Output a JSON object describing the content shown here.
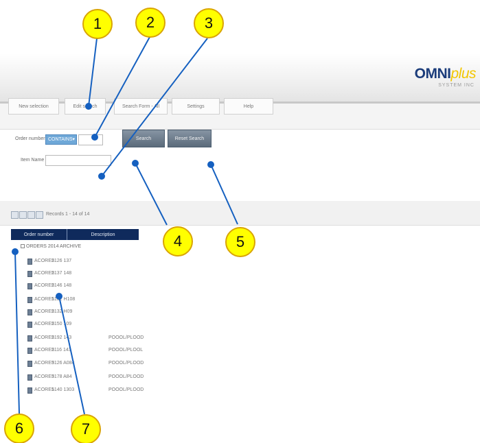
{
  "header": {
    "logo_main": "OMNI",
    "logo_accent": "plus",
    "logo_sub": "SYSTEM INC"
  },
  "tabs": [
    {
      "label": "New selection"
    },
    {
      "label": "Edit search"
    },
    {
      "label": "Search Form - All"
    },
    {
      "label": "Settings"
    },
    {
      "label": "Help"
    }
  ],
  "form": {
    "field1_label": "Order number",
    "field1_select_value": "CONTAINS",
    "field1_value": "",
    "field2_label": "Item Name",
    "field2_value": "",
    "search_button": "Search",
    "reset_button": "Reset Search"
  },
  "results": {
    "pager_text": "Records 1 - 14 of 14",
    "columns": [
      "Order number",
      "Description"
    ],
    "root_label": "ORDERS 2014 ARCHIVE",
    "rows": [
      {
        "id": "ACORE2",
        "code": "5126 137",
        "desc": ""
      },
      {
        "id": "ACORE2",
        "code": "5137 148",
        "desc": ""
      },
      {
        "id": "ACORE2",
        "code": "5146 148",
        "desc": ""
      },
      {
        "id": "ACORE1",
        "code": "5132 H108",
        "desc": ""
      },
      {
        "id": "ACORE2",
        "code": "5132 H09",
        "desc": ""
      },
      {
        "id": "ACORE2",
        "code": "5150 109",
        "desc": ""
      },
      {
        "id": "ACORE2",
        "code": "5192 143",
        "desc": "POOOL/PLOOD"
      },
      {
        "id": "ACORE2",
        "code": "5116 143",
        "desc": "POOOL/PLOOL"
      },
      {
        "id": "ACORE3",
        "code": "5126 A084",
        "desc": "POOOL/PLOOD"
      },
      {
        "id": "ACORE3",
        "code": "5178 A84",
        "desc": "POOOL/PLOOD"
      },
      {
        "id": "ACORE1",
        "code": "5140 1303",
        "desc": "POOOL/PLOOD"
      }
    ]
  },
  "callouts": [
    "1",
    "2",
    "3",
    "4",
    "5",
    "6",
    "7"
  ],
  "colors": {
    "callout_fill": "#ffff00",
    "callout_border": "#d9a400",
    "leader_line": "#1560c0",
    "grid_header": "#0f2a5c",
    "logo_blue": "#1b3c7a",
    "logo_yellow": "#f2c600"
  }
}
